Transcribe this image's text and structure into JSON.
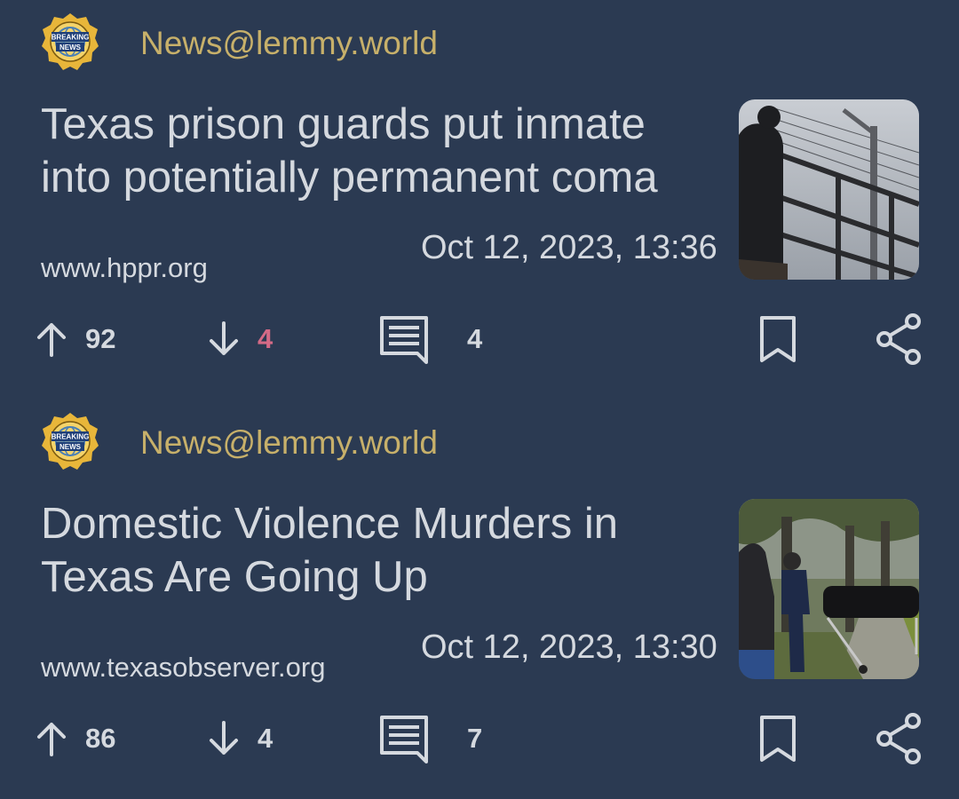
{
  "posts": [
    {
      "community": "News@lemmy.world",
      "community_badge_text": [
        "BREAKING",
        "NEWS"
      ],
      "title": "Texas prison guards put inmate into potentially permanent coma",
      "domain": "www.hppr.org",
      "date": "Oct 12, 2023, 13:36",
      "upvotes": "92",
      "downvotes": "4",
      "downvotes_highlighted": true,
      "comments": "4"
    },
    {
      "community": "News@lemmy.world",
      "community_badge_text": [
        "BREAKING",
        "NEWS"
      ],
      "title": "Domestic Violence Murders in Texas Are Going Up",
      "domain": "www.texasobserver.org",
      "date": "Oct 12, 2023, 13:30",
      "upvotes": "86",
      "downvotes": "4",
      "downvotes_highlighted": false,
      "comments": "7"
    }
  ],
  "icons": {
    "upvote": "arrow-up-icon",
    "downvote": "arrow-down-icon",
    "comments": "comment-icon",
    "save": "bookmark-icon",
    "share": "share-icon"
  },
  "colors": {
    "background": "#2b3a52",
    "community": "#c7b06a",
    "text": "#d5d9df",
    "downvote_active": "#d46a86"
  }
}
